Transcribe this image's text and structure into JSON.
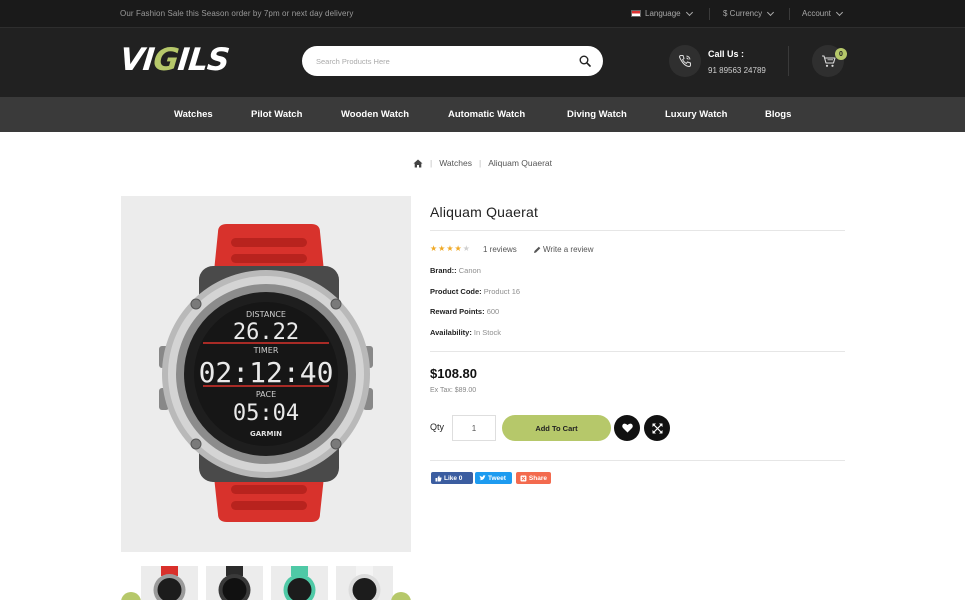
{
  "topbar": {
    "promo": "Our Fashion Sale this Season order by 7pm or next day delivery",
    "language": "Language",
    "currency": "$ Currency",
    "account": "Account"
  },
  "header": {
    "logo": "VIGILS",
    "search_placeholder": "Search Products Here",
    "call_title": "Call Us :",
    "call_number": "91 89563 24789",
    "cart_count": "0"
  },
  "nav": {
    "items": [
      "Watches",
      "Pilot Watch",
      "Wooden Watch",
      "Automatic Watch",
      "Diving Watch",
      "Luxury Watch",
      "Blogs"
    ]
  },
  "breadcrumb": {
    "items": [
      "Watches",
      "Aliquam Quaerat"
    ]
  },
  "product": {
    "title": "Aliquam Quaerat",
    "rating": 4,
    "rating_max": 5,
    "reviews": "1 reviews",
    "write_review": "Write a review",
    "specs": [
      {
        "key": "Brand::",
        "value": "Canon"
      },
      {
        "key": "Product Code:",
        "value": "Product 16"
      },
      {
        "key": "Reward Points:",
        "value": "600"
      },
      {
        "key": "Availability:",
        "value": "In Stock"
      }
    ],
    "price": "$108.80",
    "ex_tax": "Ex Tax: $89.00",
    "qty_label": "Qty",
    "qty_value": "1",
    "add_to_cart": "Add To Cart",
    "watch_face": {
      "label1": "DISTANCE",
      "value1": "26.22",
      "label2": "TIMER",
      "value2": "02:12:40",
      "label3": "PACE",
      "value3": "05:04",
      "brand": "GARMIN"
    },
    "thumbnail_colors": [
      "#d9302b",
      "#2b2b2b",
      "#4fc9a6",
      "#e8e8e8"
    ]
  },
  "social": {
    "like": "Like 0",
    "tweet": "Tweet",
    "share": "Share"
  },
  "colors": {
    "accent": "#b6c86a",
    "topbar": "#1a1a1a",
    "header": "#212121",
    "nav": "#3a3a3a"
  }
}
